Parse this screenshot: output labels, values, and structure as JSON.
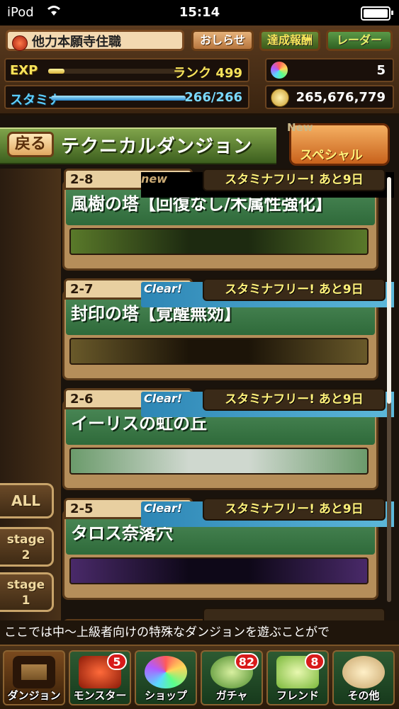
{
  "status_bar": {
    "carrier": "iPod",
    "wifi_icon": "wifi-icon",
    "time": "15:14",
    "battery_icon": "battery-icon"
  },
  "player": {
    "name": "他力本願寺住職",
    "exp_label": "EXP",
    "rank_label": "ランク 499",
    "exp_progress": 0.12,
    "stamina_label": "スタミナ",
    "stamina_value": "266/266",
    "stamina_progress": 1.0,
    "magic_stones": "5",
    "coins": "265,676,779"
  },
  "top_buttons": {
    "news": "おしらせ",
    "achievements": "達成報酬",
    "radar": "レーダー"
  },
  "header": {
    "back": "戻る",
    "title": "テクニカルダンジョン",
    "special": "スペシャル",
    "special_new": "New"
  },
  "dungeons": [
    {
      "num": "2-8",
      "status": "new",
      "name": "風樹の塔【回復なし/木属性強化】",
      "free": "スタミナフリー! あと9日"
    },
    {
      "num": "2-7",
      "status": "Clear!",
      "name": "封印の塔【覚醒無効】",
      "free": "スタミナフリー! あと9日"
    },
    {
      "num": "2-6",
      "status": "Clear!",
      "name": "イーリスの虹の丘",
      "free": "スタミナフリー! あと9日"
    },
    {
      "num": "2-5",
      "status": "Clear!",
      "name": "タロス奈落穴",
      "free": "スタミナフリー! あと9日"
    }
  ],
  "filters": {
    "all": "ALL",
    "stage2": "stage\n2",
    "stage1": "stage\n1"
  },
  "ticker": "ここでは中〜上級者向けの特殊なダンジョンを遊ぶことがで",
  "nav": [
    {
      "label": "ダンジョン",
      "icon": "dungeon-gate-icon"
    },
    {
      "label": "モンスター",
      "icon": "dragon-icon",
      "count": "5"
    },
    {
      "label": "ショップ",
      "icon": "rainbow-gem-icon"
    },
    {
      "label": "ガチャ",
      "icon": "egg-icon",
      "count": "82"
    },
    {
      "label": "フレンド",
      "icon": "friends-icon",
      "count": "8"
    },
    {
      "label": "その他",
      "icon": "question-icon"
    }
  ]
}
